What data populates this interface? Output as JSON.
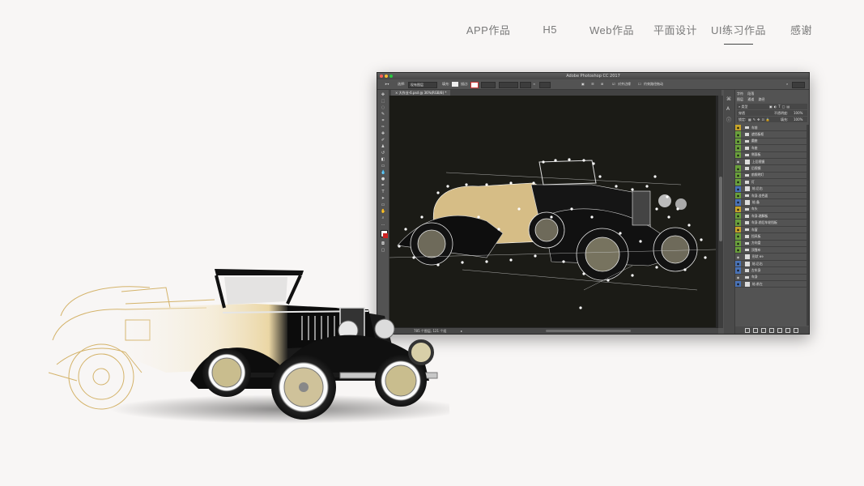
{
  "nav": {
    "items": [
      {
        "label": "APP作品",
        "active": false
      },
      {
        "label": "H5",
        "active": false
      },
      {
        "label": "Web作品",
        "active": false
      },
      {
        "label": "平面设计",
        "active": false
      },
      {
        "label": "UI练习作品",
        "active": true
      },
      {
        "label": "感谢",
        "active": false
      }
    ]
  },
  "photoshop": {
    "app_title": "Adobe Photoshop CC 2017",
    "options_bar": {
      "select_label": "选择:",
      "select_value": "现有图层",
      "fill_label": "填充:",
      "stroke_label": "描边:",
      "align_edges": "对齐边缘",
      "constrain_path": "约束路径拖动"
    },
    "document_tab": "大作业-6.psd @ 36%(RGB/8) *",
    "status_text": "785 个图层, 121 个组",
    "panels": {
      "top_tabs": [
        "字符",
        "段落"
      ],
      "layer_tabs": [
        "图层",
        "通道",
        "路径"
      ],
      "kind_filter": "类型",
      "blend_mode": "穿透",
      "opacity_label": "不透明度:",
      "opacity_value": "100%",
      "lock_label": "锁定:",
      "fill_label": "填充:",
      "fill_value": "100%"
    },
    "layers": [
      {
        "name": "车前",
        "type": "folder",
        "eye": "yellow"
      },
      {
        "name": "遮挡板框",
        "type": "folder",
        "eye": "green"
      },
      {
        "name": "圆座",
        "type": "folder",
        "eye": "green"
      },
      {
        "name": "车座",
        "type": "folder",
        "eye": "green"
      },
      {
        "name": "侧面板",
        "type": "folder",
        "eye": "green"
      },
      {
        "name": "上后视镜",
        "type": "shape",
        "eye": "none"
      },
      {
        "name": "后视镜",
        "type": "folder",
        "eye": "green"
      },
      {
        "name": "前照明灯",
        "type": "folder",
        "eye": "green"
      },
      {
        "name": "灯",
        "type": "folder",
        "eye": "green"
      },
      {
        "name": "轮-后右",
        "type": "layer",
        "eye": "blue"
      },
      {
        "name": "车身-金色面",
        "type": "folder",
        "eye": "green"
      },
      {
        "name": "轮-备",
        "type": "layer",
        "eye": "blue"
      },
      {
        "name": "车头",
        "type": "folder",
        "eye": "yellow"
      },
      {
        "name": "车身-踏脚板",
        "type": "folder",
        "eye": "green"
      },
      {
        "name": "车身-前后车轮挡板",
        "type": "folder",
        "eye": "green"
      },
      {
        "name": "车窗",
        "type": "folder",
        "eye": "yellow"
      },
      {
        "name": "挡风板",
        "type": "folder",
        "eye": "green"
      },
      {
        "name": "方向盘",
        "type": "folder",
        "eye": "green"
      },
      {
        "name": "顶篷布",
        "type": "folder",
        "eye": "green"
      },
      {
        "name": "形状 69",
        "type": "shape",
        "eye": "none"
      },
      {
        "name": "轮-后右",
        "type": "layer",
        "eye": "blue"
      },
      {
        "name": "左车身",
        "type": "folder",
        "eye": "blue"
      },
      {
        "name": "车身",
        "type": "folder",
        "eye": "none"
      },
      {
        "name": "轮-前左",
        "type": "layer",
        "eye": "blue"
      }
    ]
  }
}
